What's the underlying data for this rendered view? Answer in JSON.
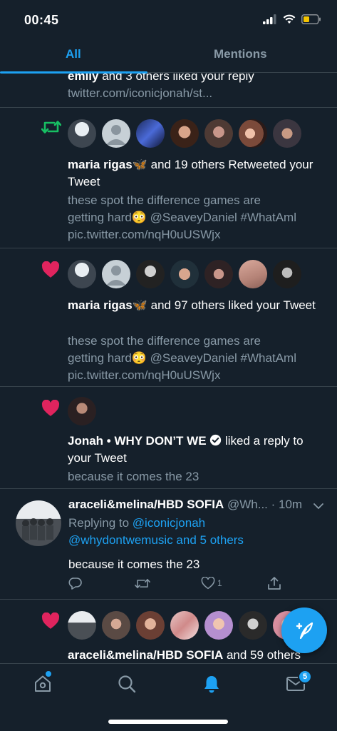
{
  "status_bar": {
    "time": "00:45"
  },
  "tabs": {
    "all": "All",
    "mentions": "Mentions"
  },
  "notifications": [
    {
      "line1_name": "emily",
      "line1_rest": " and 3 others liked your reply",
      "link": "twitter.com/iconicjonah/st..."
    },
    {
      "name": "maria rigas",
      "emoji": "🦋",
      "rest": " and 19 others Retweeted your Tweet",
      "body1": "these spot the difference games are",
      "body2": "getting hard😳 @SeaveyDaniel #WhatAml",
      "body3": "pic.twitter.com/nqH0uUSWjx"
    },
    {
      "name": "maria rigas",
      "emoji": "🦋",
      "rest": " and 97 others liked your Tweet",
      "body1": "these spot the difference games are",
      "body2": "getting hard😳 @SeaveyDaniel #WhatAml",
      "body3": "pic.twitter.com/nqH0uUSWjx"
    },
    {
      "name": "Jonah • WHY DON’T WE",
      "rest": " liked a reply to your Tweet",
      "body": "because it comes the 23"
    },
    {
      "display_name": "araceli&melina/HBD SOFIA",
      "handle": " @Wh... · 10m",
      "replying_label": "Replying to ",
      "replying_user": "@iconicjonah",
      "replying_more": "@whydontwemusic and 5 others",
      "text": "because it comes the 23",
      "like_count": "1"
    },
    {
      "name": "araceli&melina/HBD SOFIA",
      "rest": " and 59 others"
    }
  ],
  "bottom_nav": {
    "messages_badge": "5"
  },
  "colors": {
    "background": "#15202b",
    "accent": "#1da1f2",
    "like": "#e0245e",
    "retweet": "#17bf63",
    "muted": "#8899a6",
    "divider": "#38444d"
  },
  "icons": [
    "retweet-icon",
    "heart-icon",
    "verified-icon",
    "reply-icon",
    "like-icon",
    "share-icon",
    "compose-icon",
    "home-icon",
    "search-icon",
    "bell-icon",
    "mail-icon"
  ]
}
